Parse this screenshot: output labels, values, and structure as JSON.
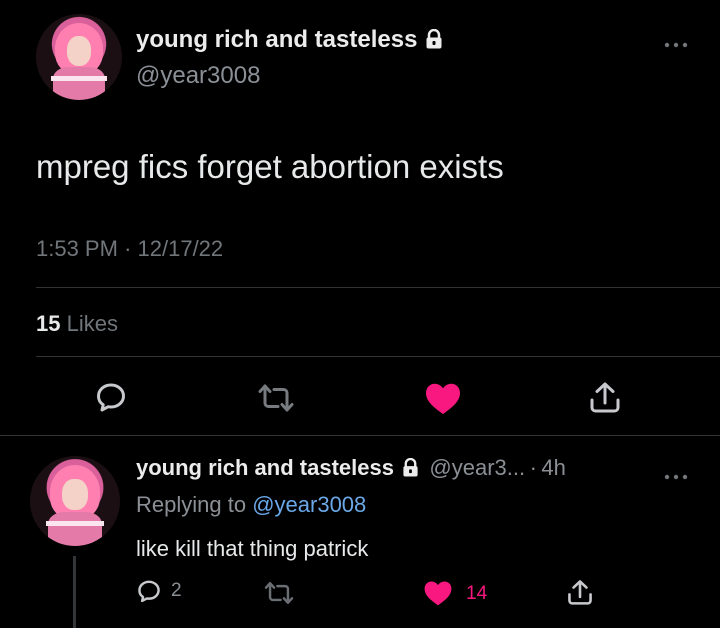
{
  "main_tweet": {
    "display_name": "young rich and tasteless",
    "handle": "@year3008",
    "text": "mpreg fics forget abortion exists",
    "time": "1:53 PM",
    "separator": "·",
    "date": "12/17/22",
    "likes_count": "15",
    "likes_label": "Likes",
    "more_icon": "more-dots-icon",
    "protected_icon": "lock-icon",
    "actions": [
      "reply-icon",
      "retweet-icon",
      "like-icon",
      "share-icon"
    ],
    "liked": true
  },
  "reply_tweet": {
    "display_name": "young rich and tasteless",
    "handle": "@year3...",
    "separator": "·",
    "age": "4h",
    "replying_prefix": "Replying to",
    "replying_to": "@year3008",
    "text": "like kill that thing patrick",
    "reply_count": "2",
    "like_count": "14",
    "liked": true
  },
  "colors": {
    "background": "#000000",
    "like_pink": "#f91880",
    "mention_blue": "#6aa8e8",
    "secondary_text": "#71767b",
    "divider": "#2f3336"
  }
}
